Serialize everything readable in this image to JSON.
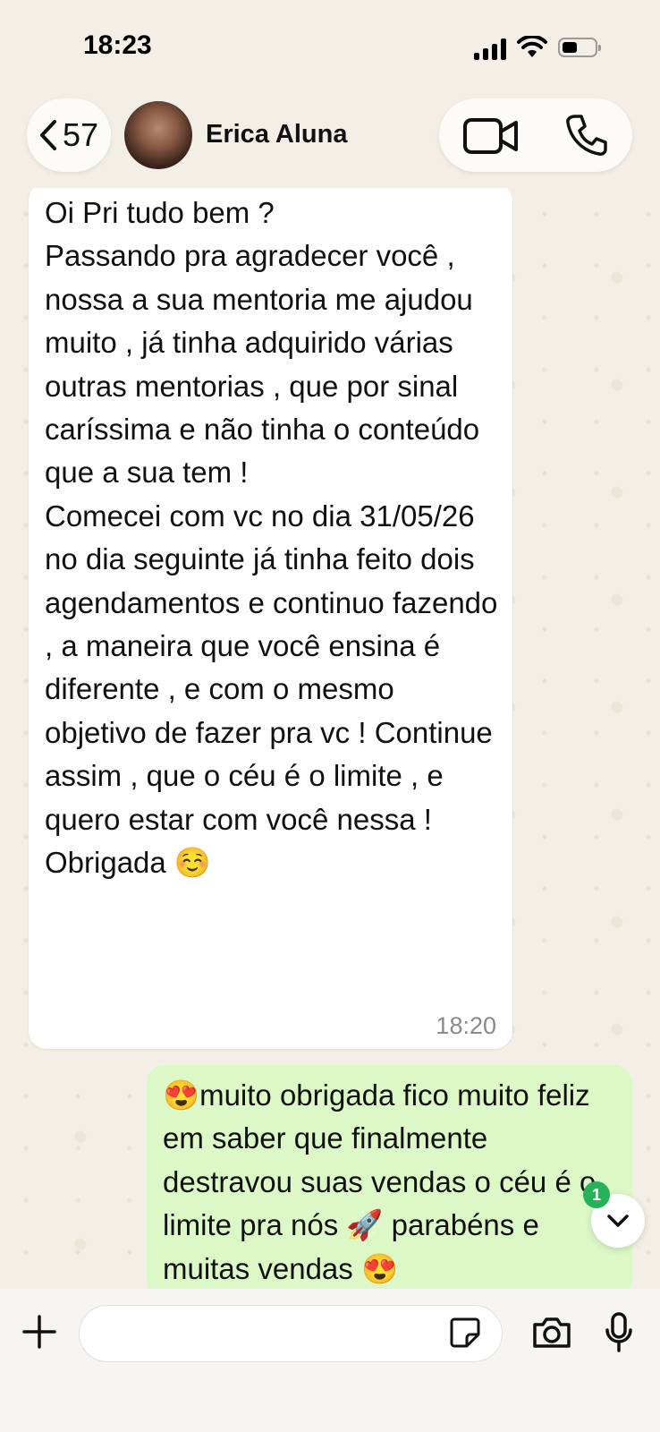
{
  "status_bar": {
    "time": "18:23"
  },
  "header": {
    "back_count": "57",
    "contact_name": "Erica Aluna",
    "icons": [
      "chevron-left-icon",
      "video-call-icon",
      "phone-icon"
    ]
  },
  "messages": [
    {
      "direction": "incoming",
      "text": "Oi Pri tudo bem ?\nPassando pra agradecer você , nossa a sua mentoria me ajudou muito , já tinha adquirido várias outras mentorias , que por sinal caríssima e não tinha o conteúdo que a sua tem !\nComecei com vc no dia 31/05/26 no dia seguinte já tinha feito dois agendamentos e continuo fazendo , a maneira que você ensina é diferente , e com o mesmo objetivo de fazer pra vc ! Continue assim , que o céu é o limite , e quero estar com você nessa ! Obrigada ☺️",
      "time": "18:20"
    },
    {
      "direction": "outgoing",
      "text": "😍muito obrigada fico muito feliz em saber que finalmente destravou suas vendas o céu é o limite pra nós 🚀 parabéns e muitas vendas 😍"
    }
  ],
  "scroll_badge": "1",
  "composer": {
    "placeholder": "",
    "icons": [
      "plus-icon",
      "sticker-icon",
      "camera-icon",
      "microphone-icon"
    ]
  },
  "colors": {
    "background": "#f3efe7",
    "incoming_bubble": "#ffffff",
    "outgoing_bubble": "#dcf8c7",
    "badge": "#25b35a"
  }
}
